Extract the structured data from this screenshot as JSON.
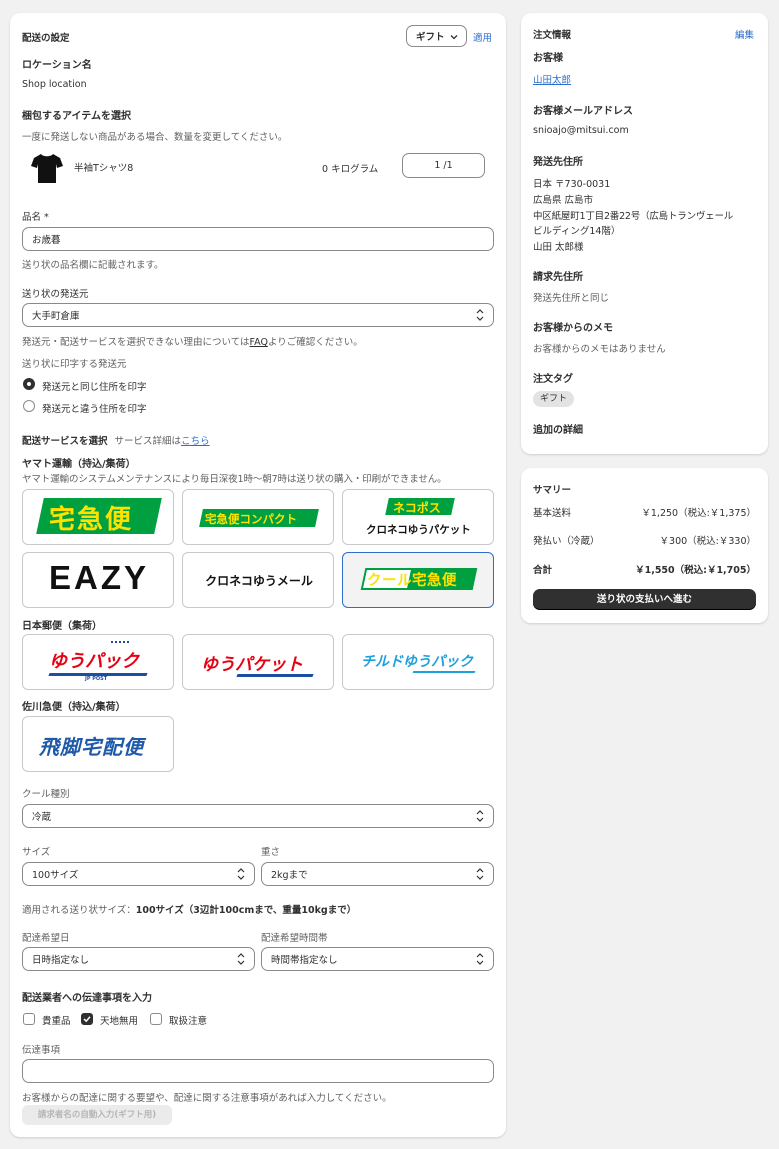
{
  "shipping": {
    "title": "配送の設定",
    "preset_value": "ギフト",
    "apply_label": "適用",
    "location_label": "ロケーション名",
    "location_value": "Shop location",
    "items_label": "梱包するアイテムを選択",
    "items_help": "一度に発送しない商品がある場合、数量を変更してください。",
    "item": {
      "name": "半袖Tシャツ8",
      "weight": "0 キログラム",
      "qty": "1 /1"
    },
    "product_name_label": "品名 *",
    "product_name_value": "お歳暮",
    "product_name_help": "送り状の品名欄に記載されます。",
    "origin_label": "送り状の発送元",
    "origin_value": "大手町倉庫",
    "origin_help_pre": "発送元・配送サービスを選択できない理由については",
    "origin_help_link": "FAQ",
    "origin_help_post": "よりご確認ください。",
    "print_origin_label": "送り状に印字する発送元",
    "radio_same": "発送元と同じ住所を印字",
    "radio_diff": "発送元と違う住所を印字",
    "service_label": "配送サービスを選択",
    "service_detail_pre": "サービス詳細は",
    "service_detail_link": "こちら",
    "yamato_label": "ヤマト運輸（持込/集荷）",
    "yamato_note": "ヤマト運輸のシステムメンテナンスにより毎日深夜1時～朝7時は送り状の購入・印刷ができません。",
    "tiles_yamato": [
      "宅急便",
      "宅急便コンパクト",
      "ネコポス",
      "クロネコゆうパケット",
      "EAZY",
      "クロネコゆうメール",
      "クール宅急便"
    ],
    "japanpost_label": "日本郵便（集荷）",
    "tiles_japanpost": [
      "ゆうパック",
      "JP POST",
      "ゆうパケット",
      "チルドゆうパック"
    ],
    "sagawa_label": "佐川急便（持込/集荷）",
    "tiles_sagawa": [
      "飛脚宅配便"
    ],
    "cool_label": "クール種別",
    "cool_value": "冷蔵",
    "size_label": "サイズ",
    "size_value": "100サイズ",
    "weight_label": "重さ",
    "weight_value": "2kgまで",
    "applied_size_pre": "適用される送り状サイズ：",
    "applied_size_value": "100サイズ（3辺計100cmまで、重量10kgまで）",
    "date_label": "配達希望日",
    "date_value": "日時指定なし",
    "time_label": "配達希望時間帯",
    "time_value": "時間帯指定なし",
    "notes_label": "配送業者への伝達事項を入力",
    "check_valuable": "貴重品",
    "check_upright": "天地無用",
    "check_fragile": "取扱注意",
    "message_label": "伝達事項",
    "message_value": "",
    "message_help": "お客様からの配達に関する要望や、配達に関する注意事項があれば入力してください。",
    "autofill_button": "請求者名の自動入力(ギフト用)"
  },
  "order": {
    "title": "注文情報",
    "edit": "編集",
    "customer_label": "お客様",
    "customer_name": "山田太郎",
    "email_label": "お客様メールアドレス",
    "email": "snioajo@mitsui.com",
    "ship_label": "発送先住所",
    "ship_lines": [
      "日本 〒730-0031",
      "広島県 広島市",
      "中区紙屋町1丁目2番22号（広島トランヴェール",
      "ビルディング14階）",
      "山田 太郎様"
    ],
    "bill_label": "請求先住所",
    "bill_value": "発送先住所と同じ",
    "memo_label": "お客様からのメモ",
    "memo_value": "お客様からのメモはありません",
    "tag_label": "注文タグ",
    "tag_value": "ギフト",
    "extra_label": "追加の詳細"
  },
  "summary": {
    "title": "サマリー",
    "base_label": "基本送料",
    "base_value": "￥1,250（税込:￥1,375）",
    "payment_label": "発払い（冷蔵）",
    "payment_value": "￥300（税込:￥330）",
    "total_label": "合計",
    "total_value": "￥1,550（税込:￥1,705）",
    "pay_button": "送り状の支払いへ進む"
  },
  "colors": {
    "yamato_green": "#00a040",
    "yamato_yellow": "#ffe100",
    "japanpost_red": "#e60012",
    "japanpost_blue": "#1e4ea3",
    "chilled_cyan": "#1ea0dc",
    "sagawa_blue": "#1e5aa8",
    "link_blue": "#2c6ecb"
  }
}
